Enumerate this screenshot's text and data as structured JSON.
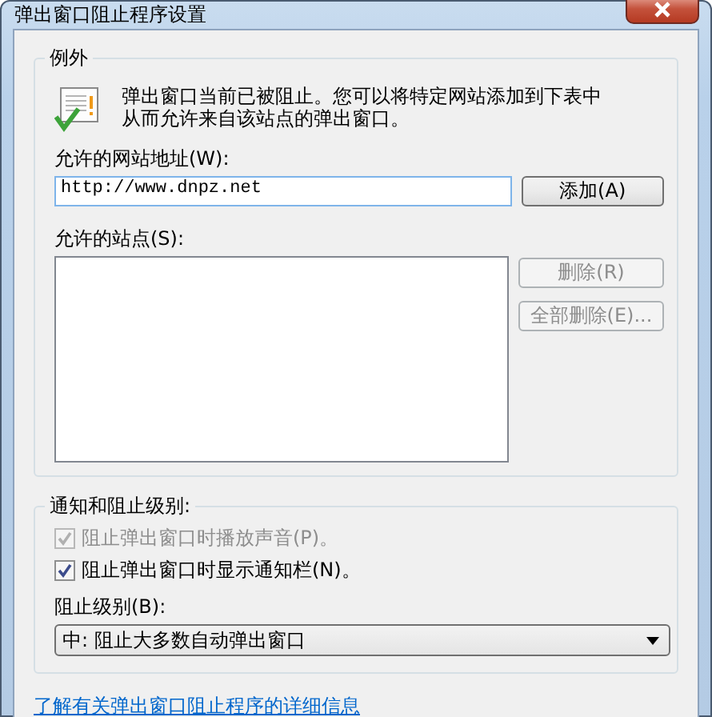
{
  "window": {
    "title": "弹出窗口阻止程序设置"
  },
  "exceptions": {
    "title": "例外",
    "message": "弹出窗口当前已被阻止。您可以将特定网站添加到下表中从而允许来自该站点的弹出窗口。",
    "address_label": "允许的网站地址(W):",
    "address_value": "http://www.dnpz.net",
    "add_button": {
      "label": "添加(A)",
      "disabled": false
    },
    "sites_label": "允许的站点(S):",
    "buttons": [
      {
        "label": "删除(R)",
        "disabled": true
      },
      {
        "label": "全部删除(E)...",
        "disabled": true
      }
    ]
  },
  "notification": {
    "title": "通知和阻止级别:",
    "options": [
      {
        "label": "阻止弹出窗口时播放声音(P)。",
        "checked": true,
        "disabled": true
      },
      {
        "label": "阻止弹出窗口时显示通知栏(N)。",
        "checked": true,
        "disabled": false
      }
    ],
    "level_label": "阻止级别(B):",
    "level_value": "中: 阻止大多数自动弹出窗口"
  },
  "link": "了解有关弹出窗口阻止程序的详细信息"
}
